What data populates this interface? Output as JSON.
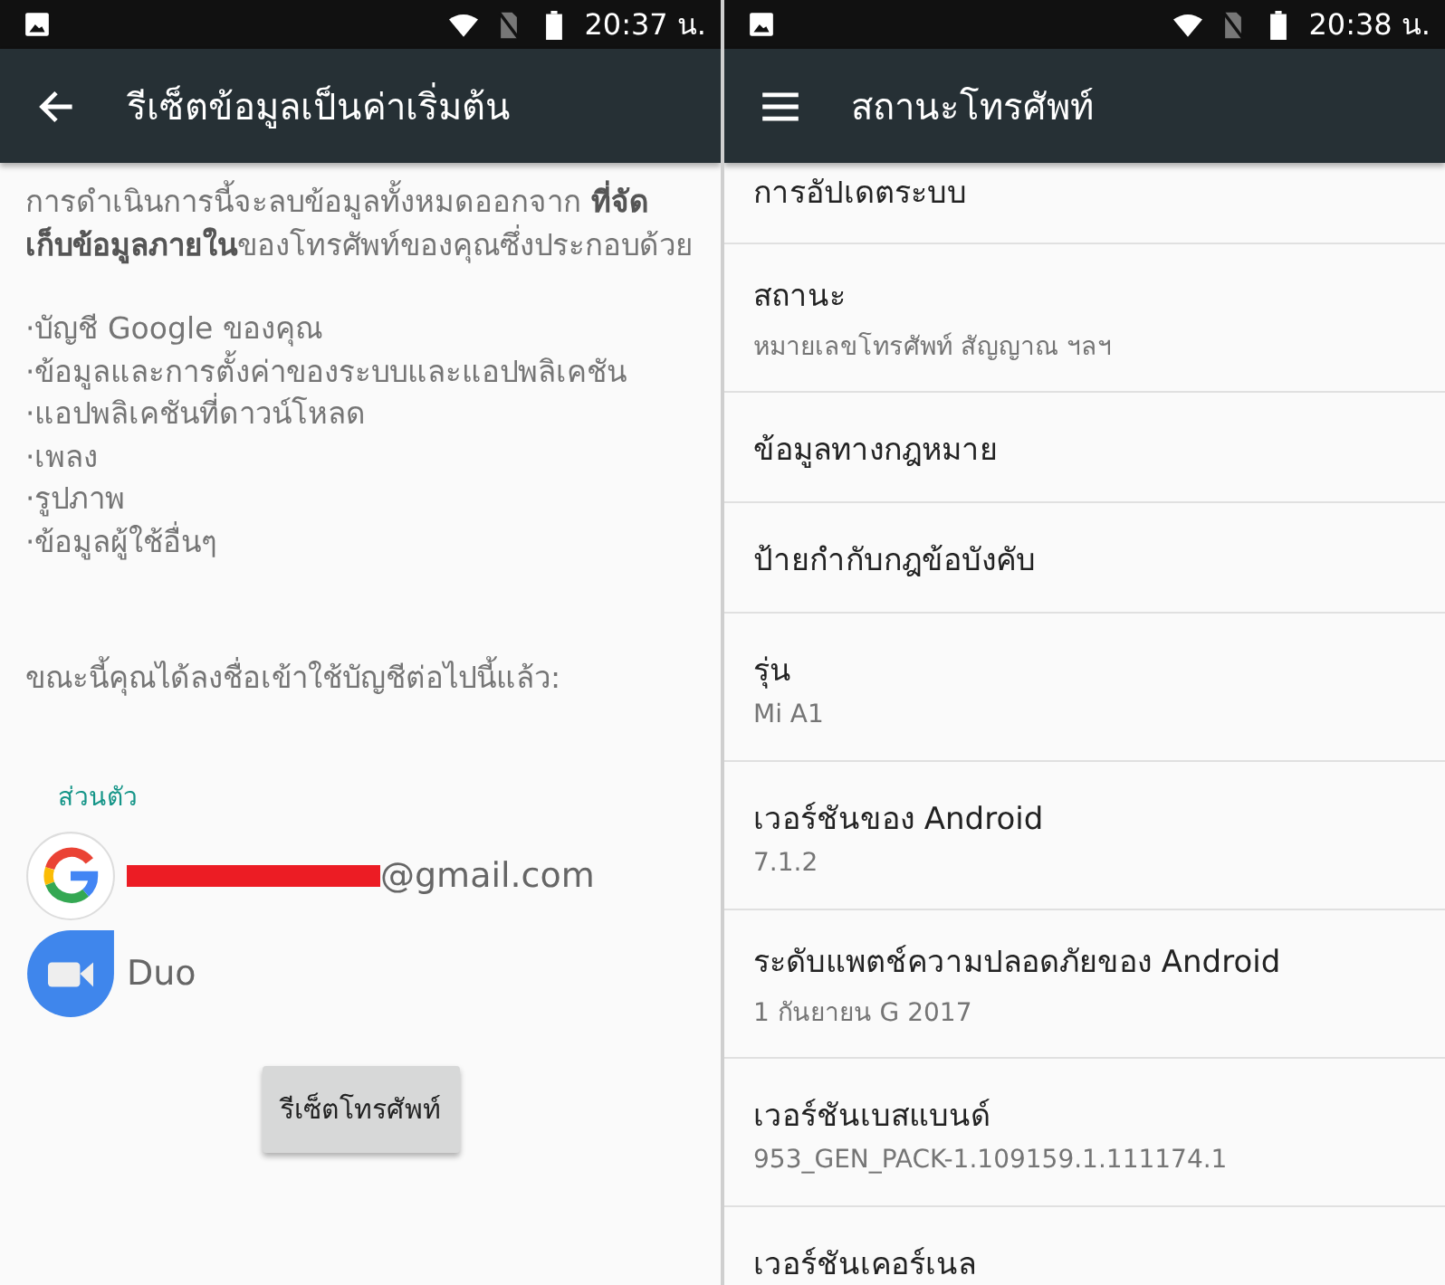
{
  "screens": [
    {
      "status_bar": {
        "time": "20:37 น."
      },
      "app_bar": {
        "kind": "back",
        "title": "รีเซ็ตข้อมูลเป็นค่าเริ่มต้น"
      },
      "intro": "การดำเนินการนี้จะลบข้อมูลทั้งหมดออกจาก **ที่จัดเก็บข้อมูลภายใน**ของโทรศัพท์ของคุณซึ่งประกอบด้วย",
      "items": [
        "·บัญชี Google ของคุณ",
        "·ข้อมูลและการตั้งค่าของระบบและแอปพลิเคชัน",
        "·แอปพลิเคชันที่ดาวน์โหลด",
        "·เพลง",
        "·รูปภาพ",
        "·ข้อมูลผู้ใช้อื่นๆ"
      ],
      "accounts_note": "ขณะนี้คุณได้ลงชื่อเข้าใช้บัญชีต่อไปนี้แล้ว:",
      "section": "ส่วนตัว",
      "accounts": [
        {
          "kind": "google",
          "label": "@gmail.com",
          "redacted": true
        },
        {
          "kind": "duo",
          "label": "Duo",
          "redacted": false
        }
      ],
      "button": "รีเซ็ตโทรศัพท์"
    },
    {
      "status_bar": {
        "time": "20:38 น."
      },
      "app_bar": {
        "kind": "menu",
        "title": "สถานะโทรศัพท์"
      },
      "rows": [
        {
          "title": "การอัปเดตระบบ"
        },
        {
          "title": "สถานะ",
          "summary": "หมายเลขโทรศัพท์ สัญญาณ ฯลฯ"
        },
        {
          "title": "ข้อมูลทางกฎหมาย"
        },
        {
          "title": "ป้ายกำกับกฎข้อบังคับ"
        },
        {
          "title": "รุ่น",
          "summary": "Mi A1"
        },
        {
          "title": "เวอร์ชันของ Android",
          "summary": "7.1.2"
        },
        {
          "title": "ระดับแพตช์ความปลอดภัยของ Android",
          "summary": "1 กันยายน G 2017"
        },
        {
          "title": "เวอร์ชันเบสแบนด์",
          "summary": "953_GEN_PACK-1.109159.1.111174.1"
        },
        {
          "title": "เวอร์ชันเคอร์เนล"
        }
      ]
    }
  ]
}
